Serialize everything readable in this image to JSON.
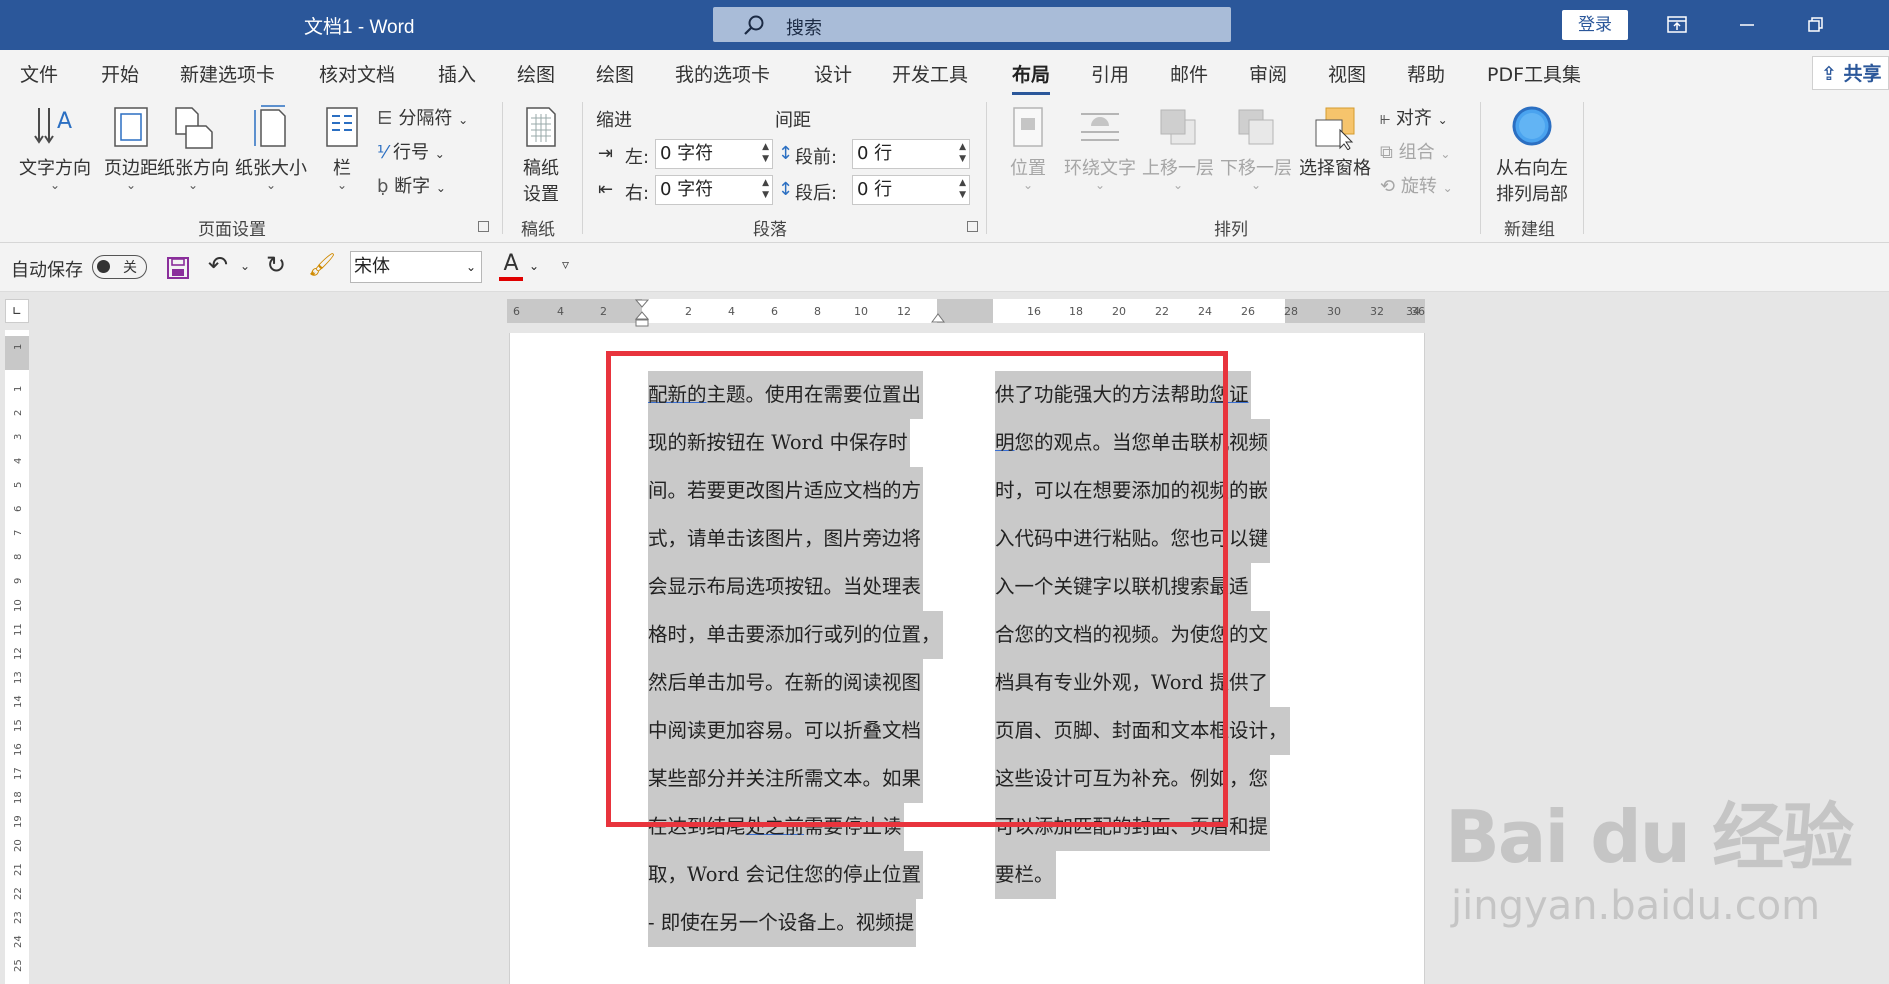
{
  "titlebar": {
    "doc_title": "文档1  -  Word",
    "search_label": "搜索",
    "login_label": "登录"
  },
  "tabs": [
    {
      "label": "文件"
    },
    {
      "label": "开始"
    },
    {
      "label": "新建选项卡"
    },
    {
      "label": "核对文档"
    },
    {
      "label": "插入"
    },
    {
      "label": "绘图"
    },
    {
      "label": "绘图"
    },
    {
      "label": "我的选项卡"
    },
    {
      "label": "设计"
    },
    {
      "label": "开发工具"
    },
    {
      "label": "布局"
    },
    {
      "label": "引用"
    },
    {
      "label": "邮件"
    },
    {
      "label": "审阅"
    },
    {
      "label": "视图"
    },
    {
      "label": "帮助"
    },
    {
      "label": "PDF工具集"
    }
  ],
  "active_tab": "布局",
  "share_label": "共享",
  "ribbon": {
    "page_setup": {
      "text_direction": "文字方向",
      "margins": "页边距",
      "orientation": "纸张方向",
      "size": "纸张大小",
      "columns": "栏",
      "breaks": "分隔符",
      "line_numbers": "行号",
      "hyphenation": "断字",
      "group": "页面设置"
    },
    "manuscript": {
      "button": "稿纸设置",
      "button_line1": "稿纸",
      "button_line2": "设置",
      "group": "稿纸"
    },
    "paragraph": {
      "indent_title": "缩进",
      "spacing_title": "间距",
      "left_label": "左:",
      "right_label": "右:",
      "left_value": "0 字符",
      "right_value": "0 字符",
      "before_label": "段前:",
      "after_label": "段后:",
      "before_value": "0 行",
      "after_value": "0 行",
      "group": "段落"
    },
    "arrange": {
      "position": "位置",
      "wrap_text": "环绕文字",
      "bring_forward": "上移一层",
      "send_backward": "下移一层",
      "selection_pane": "选择窗格",
      "align": "对齐",
      "group_objects": "组合",
      "rotate": "旋转",
      "group": "排列"
    },
    "new_group": {
      "button_line1": "从右向左",
      "button_line2": "排列局部",
      "group": "新建组"
    }
  },
  "qat": {
    "autosave_label": "自动保存",
    "toggle_state": "关",
    "font_name": "宋体"
  },
  "ruler": {
    "h_numbers": [
      "6",
      "4",
      "2",
      "2",
      "4",
      "6",
      "8",
      "10",
      "12",
      "16",
      "18",
      "20",
      "22",
      "24",
      "26",
      "28",
      "30",
      "32",
      "34",
      "36"
    ],
    "v_numbers": [
      "1",
      "1",
      "2",
      "3",
      "4",
      "5",
      "6",
      "7",
      "8",
      "9",
      "10",
      "11",
      "12",
      "13",
      "14",
      "15",
      "16",
      "17",
      "18",
      "19",
      "20",
      "21",
      "22",
      "23",
      "24",
      "25"
    ]
  },
  "document": {
    "col1": [
      {
        "u": "配新的",
        "t": "主题。使用在需要位置出"
      },
      {
        "t": "现的新按钮在  Word  中保存时"
      },
      {
        "t": "间。若要更改图片适应文档的方"
      },
      {
        "t": "式，请单击该图片，图片旁边将"
      },
      {
        "t": "会显示布局选项按钮。当处理表"
      },
      {
        "t": "格时，单击要添加行或列的位置，"
      },
      {
        "t": "然后单击加号。在新的阅读视图"
      },
      {
        "t": "中阅读更加容易。可以折叠文档"
      },
      {
        "t": "某些部分并关注所需文本。如果"
      },
      {
        "t": "在达到结尾",
        "u": "处之前",
        "t2": "需要停止读"
      },
      {
        "t": "取，Word  会记住您的停止位置"
      },
      {
        "t": "- 即使在另一个设备上。视频提"
      }
    ],
    "col2": [
      {
        "t": "供了功能强大的方法帮助",
        "u": "您证"
      },
      {
        "u": "明",
        "t2": "您的观点。当您单击联机视频"
      },
      {
        "t": "时，可以在想要添加的视频的嵌"
      },
      {
        "t": "入代码中进行粘贴。您也可以键"
      },
      {
        "t": "入一个关键字以联机搜索最适"
      },
      {
        "t": "合您的文档的视频。为使您的文"
      },
      {
        "t": "档具有专业外观，Word  提供了"
      },
      {
        "t": "页眉、页脚、封面和文本框设计，"
      },
      {
        "t": "这些设计可互为补充。例如，您"
      },
      {
        "t": "可以添加匹配的封面、页眉和提"
      },
      {
        "t": "要栏。"
      }
    ]
  },
  "watermark": {
    "brand": "Bai du 经验",
    "url": "jingyan.baidu.com"
  },
  "colors": {
    "title_bar": "#2b579a",
    "highlight": "#c9c9c9",
    "annotation_box": "#e8343d",
    "font_color_bar": "#e00000"
  }
}
